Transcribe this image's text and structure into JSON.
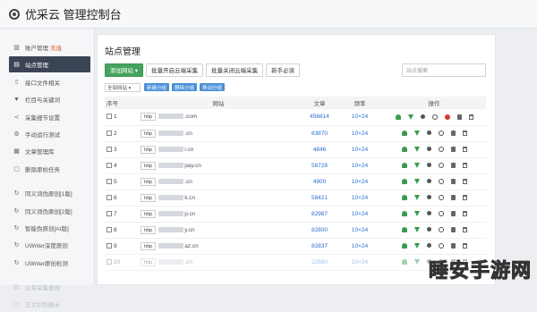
{
  "app": {
    "title": "优采云 管理控制台"
  },
  "sidebar": {
    "items": [
      {
        "icon": "bar-chart-icon",
        "glyph": "▥",
        "label": "账户管理",
        "badge": "充值",
        "active": false,
        "dim": false
      },
      {
        "icon": "list-icon",
        "glyph": "▤",
        "label": "站点管理",
        "active": true,
        "dim": false
      },
      {
        "icon": "upload-icon",
        "glyph": "⇧",
        "label": "接口文件相关",
        "active": false,
        "dim": false
      },
      {
        "icon": "filter-icon",
        "glyph": "▼",
        "label": "栏目与关键词",
        "active": false,
        "dim": false
      },
      {
        "icon": "share-icon",
        "glyph": "≺",
        "label": "采集细节设置",
        "active": false,
        "dim": false
      },
      {
        "icon": "gear-icon",
        "glyph": "⚙",
        "label": "手动运行测试",
        "active": false,
        "dim": false
      },
      {
        "icon": "database-icon",
        "glyph": "▦",
        "label": "文章管理库",
        "active": false,
        "dim": false
      },
      {
        "icon": "trash-icon",
        "glyph": "▢",
        "label": "删除原始任务",
        "active": false,
        "dim": false
      },
      {
        "sep": true
      },
      {
        "icon": "sync-icon",
        "glyph": "↻",
        "label": "同义词伪原创[1版]",
        "active": false,
        "dim": false
      },
      {
        "icon": "sync-icon",
        "glyph": "↻",
        "label": "同义词伪原创[2版]",
        "active": false,
        "dim": false
      },
      {
        "icon": "sync-icon",
        "glyph": "↻",
        "label": "智能伪原创[AI版]",
        "active": false,
        "dim": false
      },
      {
        "icon": "sync-icon",
        "glyph": "↻",
        "label": "UWriter深度原创",
        "active": false,
        "dim": false
      },
      {
        "icon": "sync-icon",
        "glyph": "↻",
        "label": "UWriter原创检测",
        "active": false,
        "dim": false
      },
      {
        "sep": true
      },
      {
        "icon": "book-icon",
        "glyph": "▤",
        "label": "公有采集查阅",
        "active": false,
        "dim": true
      },
      {
        "icon": "monitor-icon",
        "glyph": "▭",
        "label": "正文识别展示",
        "active": false,
        "dim": true
      }
    ]
  },
  "main": {
    "page_title": "站点管理",
    "toolbar": {
      "add_site": "添加网站 ▾",
      "batch_enable": "批量开启云端采集",
      "batch_disable": "批量关闭云端采集",
      "newbie": "新手必读",
      "search_placeholder": "站点搜索"
    },
    "filter": {
      "select_value": "全部网站 ▾",
      "new_group": "新建分组",
      "delete_group": "删除分组",
      "move_group": "移动分组"
    },
    "table": {
      "headers": {
        "id": "序号",
        "site": "网站",
        "articles": "文章",
        "freq": "频率",
        "ops": "操作"
      },
      "rows": [
        {
          "id": "1",
          "proto": "http",
          "domain": ".com",
          "articles": "456814",
          "freq": "10×24",
          "del": true,
          "faded": false
        },
        {
          "id": "2",
          "proto": "http",
          "domain": ".cn",
          "articles": "83870",
          "freq": "10×24",
          "del": false,
          "faded": false
        },
        {
          "id": "3",
          "proto": "http",
          "domain": "i.cn",
          "articles": "4846",
          "freq": "10×24",
          "del": false,
          "faded": false
        },
        {
          "id": "4",
          "proto": "http",
          "domain": "pay.cn",
          "articles": "58728",
          "freq": "10×24",
          "del": false,
          "faded": false
        },
        {
          "id": "5",
          "proto": "http",
          "domain": ".cn",
          "articles": "4900",
          "freq": "10×24",
          "del": false,
          "faded": false
        },
        {
          "id": "6",
          "proto": "http",
          "domain": "k.cn",
          "articles": "58421",
          "freq": "10×24",
          "del": false,
          "faded": false
        },
        {
          "id": "7",
          "proto": "http",
          "domain": "p.cn",
          "articles": "82987",
          "freq": "10×24",
          "del": false,
          "faded": false
        },
        {
          "id": "8",
          "proto": "http",
          "domain": "y.cn",
          "articles": "82800",
          "freq": "10×24",
          "del": false,
          "faded": false
        },
        {
          "id": "9",
          "proto": "http",
          "domain": "az.cn",
          "articles": "82837",
          "freq": "10×24",
          "del": false,
          "faded": false
        },
        {
          "id": "10",
          "proto": "http",
          "domain": ".cn",
          "articles": "22980",
          "freq": "10×24",
          "del": false,
          "faded": true
        }
      ]
    }
  },
  "watermark": "睡安手游网",
  "colors": {
    "accent_green": "#45a35e",
    "link_blue": "#2a6fc9",
    "sidebar_active": "#3b4455",
    "danger_red": "#d9372f"
  }
}
